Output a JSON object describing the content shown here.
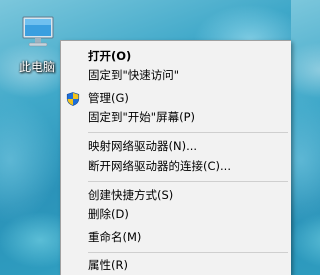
{
  "desktop": {
    "icon_label": "此电脑",
    "icon_name": "computer-monitor-icon"
  },
  "context_menu": {
    "items": [
      {
        "label": "打开(O)",
        "bold": true
      },
      {
        "label": "固定到\"快速访问\""
      },
      {
        "label": "管理(G)",
        "icon": "shield-icon"
      },
      {
        "label": "固定到\"开始\"屏幕(P)"
      },
      {
        "label": "映射网络驱动器(N)..."
      },
      {
        "label": "断开网络驱动器的连接(C)..."
      },
      {
        "label": "创建快捷方式(S)"
      },
      {
        "label": "删除(D)"
      },
      {
        "label": "重命名(M)"
      },
      {
        "label": "属性(R)"
      }
    ]
  },
  "colors": {
    "menu_background": "#f2f2f2",
    "menu_border": "#a0a0a0",
    "separator": "#cfcfcf",
    "shield_blue": "#1e6fd9",
    "shield_yellow": "#f3c31b"
  }
}
